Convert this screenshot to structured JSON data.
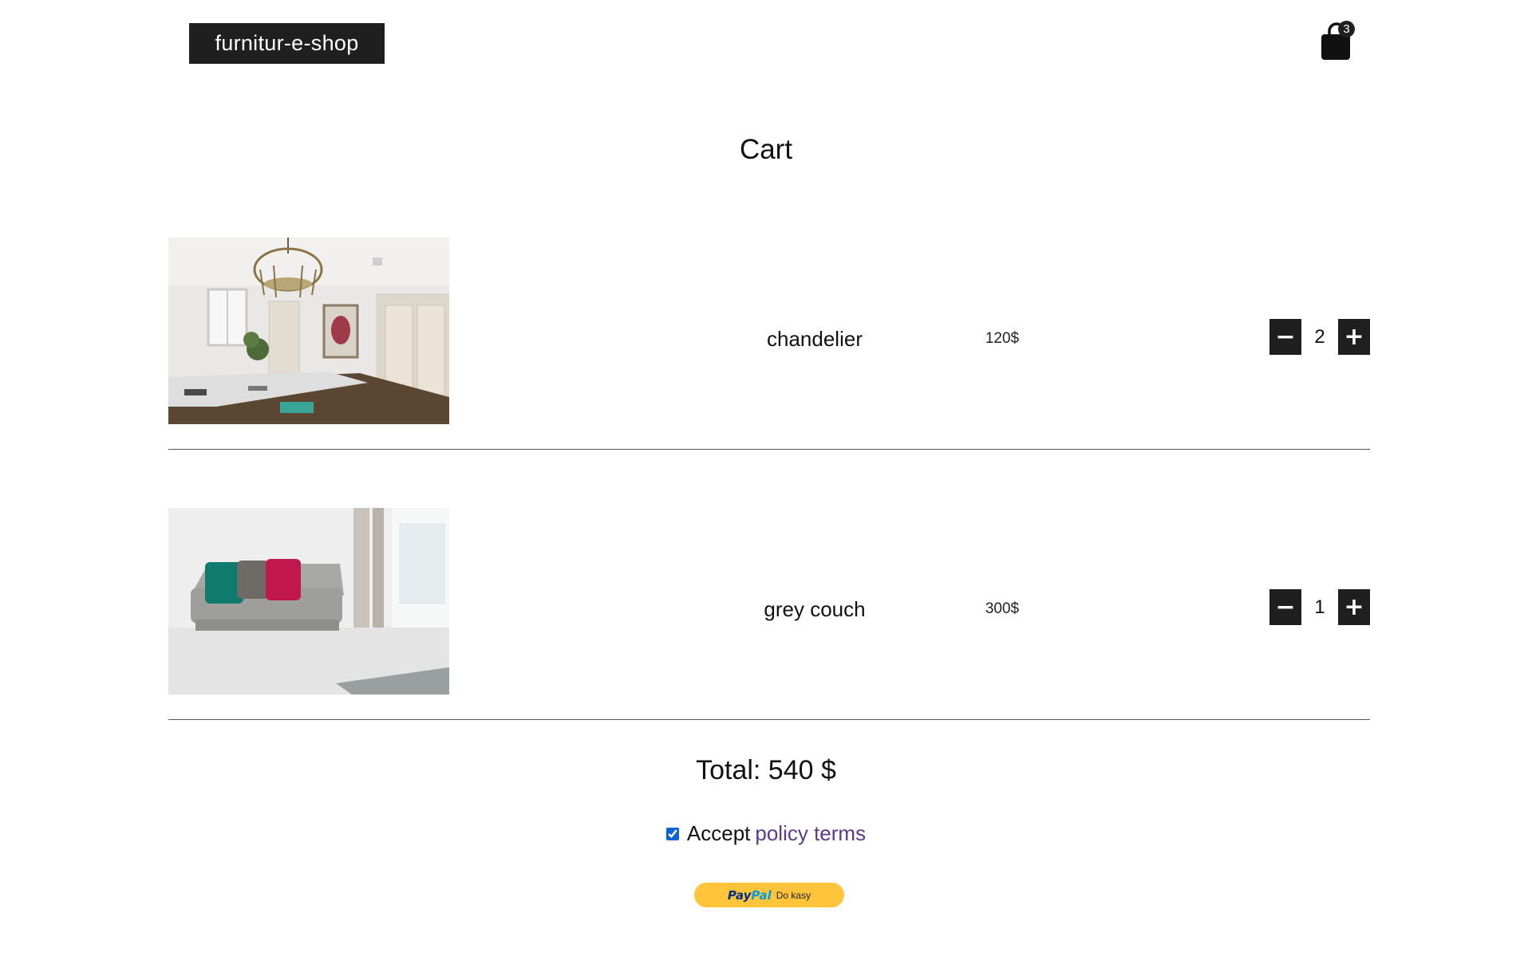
{
  "header": {
    "logo_text": "furnitur-e-shop",
    "cart_count": "3"
  },
  "page": {
    "title": "Cart"
  },
  "cart": {
    "items": [
      {
        "name": "chandelier",
        "price": "120$",
        "quantity": "2",
        "image": "chandelier-room-photo"
      },
      {
        "name": "grey couch",
        "price": "300$",
        "quantity": "1",
        "image": "grey-couch-photo"
      }
    ],
    "minus_label": "−",
    "plus_label": "+"
  },
  "summary": {
    "total": "Total: 540 $"
  },
  "terms": {
    "accept_label": "Accept",
    "link_text": "policy terms",
    "checked": true
  },
  "paypal": {
    "brand_pay": "Pay",
    "brand_pal": "Pal",
    "label": "Do kasy"
  },
  "colors": {
    "dark": "#1f1f1f",
    "link": "#5b3a8a",
    "paypal_yellow": "#ffc439"
  }
}
